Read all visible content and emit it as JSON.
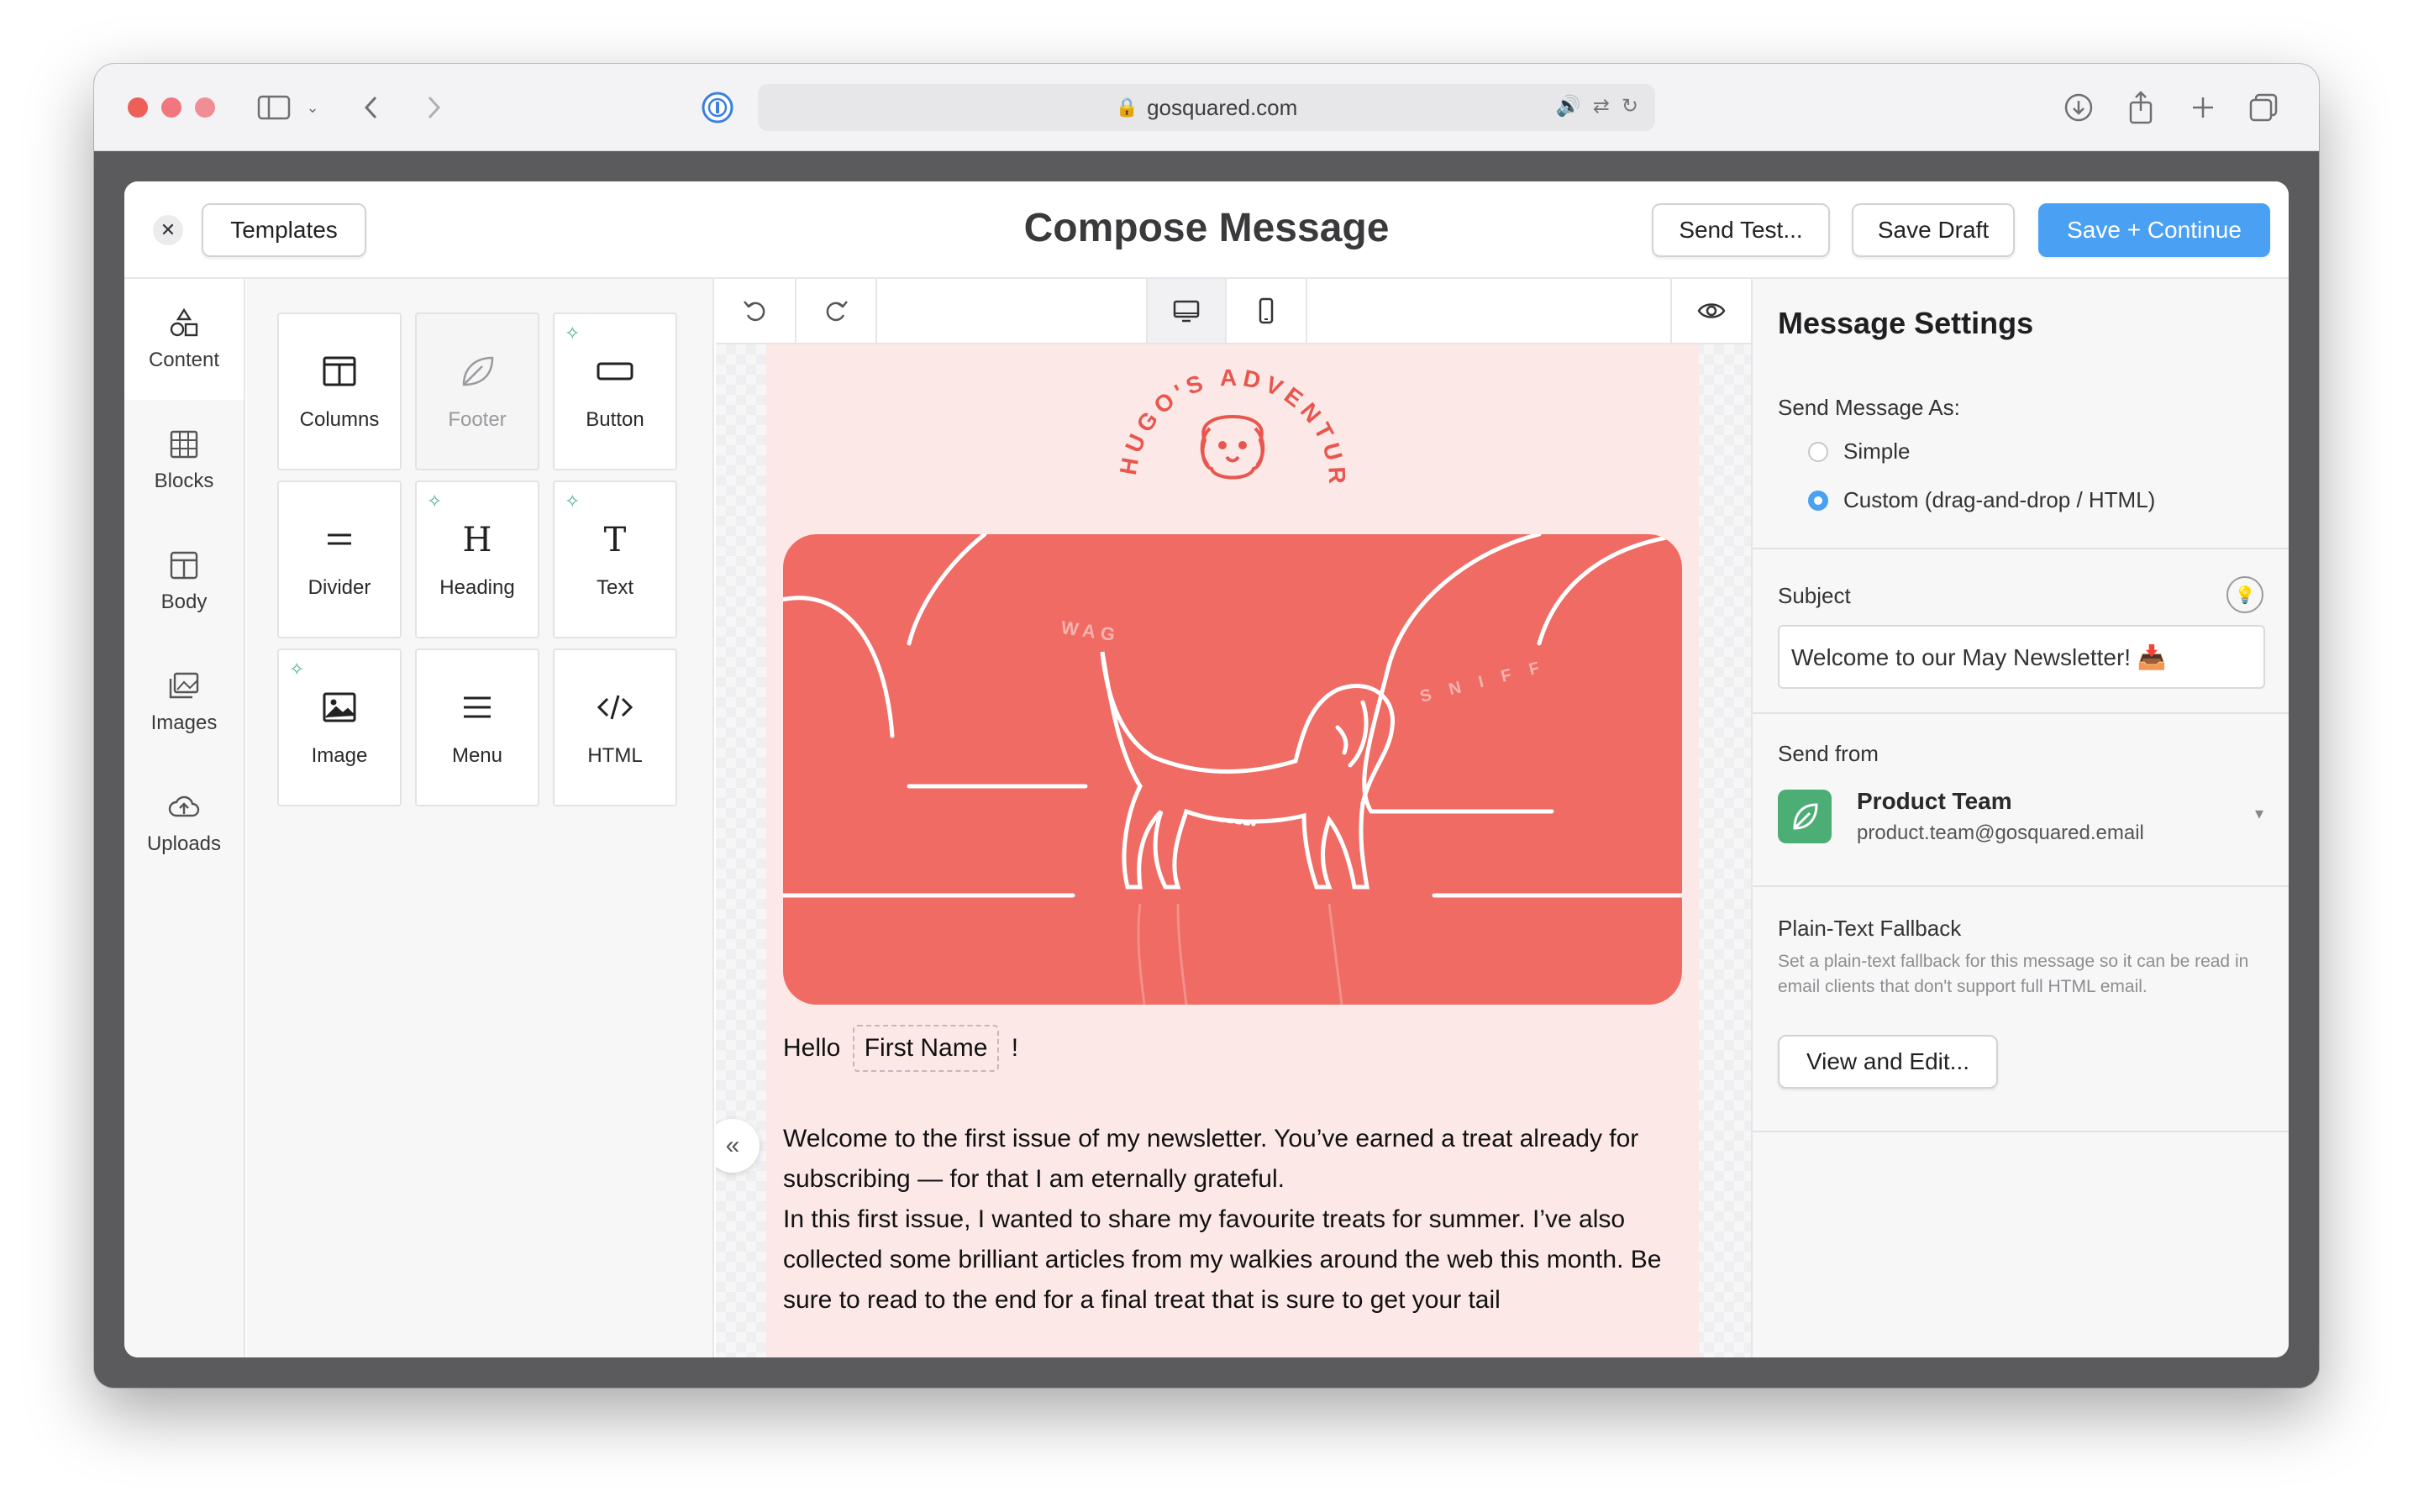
{
  "browser": {
    "url": "gosquared.com"
  },
  "header": {
    "templates_label": "Templates",
    "title": "Compose Message",
    "send_test_label": "Send Test...",
    "save_draft_label": "Save Draft",
    "save_continue_label": "Save + Continue"
  },
  "rail": {
    "items": [
      {
        "label": "Content",
        "icon": "shapes-icon"
      },
      {
        "label": "Blocks",
        "icon": "blocks-icon"
      },
      {
        "label": "Body",
        "icon": "layout-icon"
      },
      {
        "label": "Images",
        "icon": "images-icon"
      },
      {
        "label": "Uploads",
        "icon": "cloud-upload-icon"
      }
    ]
  },
  "tiles": [
    {
      "label": "Columns",
      "icon": "columns-icon",
      "new": false,
      "disabled": false
    },
    {
      "label": "Footer",
      "icon": "leaf-icon",
      "new": false,
      "disabled": true
    },
    {
      "label": "Button",
      "icon": "button-icon",
      "new": true,
      "disabled": false
    },
    {
      "label": "Divider",
      "icon": "divider-icon",
      "new": false,
      "disabled": false
    },
    {
      "label": "Heading",
      "icon": "heading-icon",
      "new": true,
      "disabled": false
    },
    {
      "label": "Text",
      "icon": "text-icon",
      "new": true,
      "disabled": false
    },
    {
      "label": "Image",
      "icon": "image-icon",
      "new": true,
      "disabled": false
    },
    {
      "label": "Menu",
      "icon": "menu-icon",
      "new": false,
      "disabled": false
    },
    {
      "label": "HTML",
      "icon": "code-icon",
      "new": false,
      "disabled": false
    }
  ],
  "email": {
    "logo_text": "HUGO'S ADVENTURES",
    "hero_words": {
      "wag": "WAG",
      "sniff": "SNIFF"
    },
    "greeting_prefix": "Hello",
    "merge_tag": "First Name",
    "greeting_suffix": "!",
    "paragraph1": "Welcome to the first issue of my newsletter. You’ve earned a treat already for subscribing — for that I am eternally grateful.",
    "paragraph2": "In this first issue, I wanted to share my favourite treats for summer. I’ve also collected some brilliant articles from my walkies around the web this month. Be sure to read to the end for a final treat that is sure to get your tail"
  },
  "settings": {
    "title": "Message Settings",
    "send_as_label": "Send Message As:",
    "options": [
      {
        "label": "Simple",
        "selected": false
      },
      {
        "label": "Custom (drag-and-drop / HTML)",
        "selected": true
      }
    ],
    "subject_label": "Subject",
    "subject_value": "Welcome to our May Newsletter! 📥",
    "send_from_label": "Send from",
    "sender_name": "Product Team",
    "sender_email": "product.team@gosquared.email",
    "plaintext_label": "Plain-Text Fallback",
    "plaintext_help": "Set a plain-text fallback for this message so it can be read in email clients that don't support full HTML email.",
    "view_edit_label": "View and Edit..."
  },
  "colors": {
    "accent": "#4aa1f3",
    "hero": "#ef6b63",
    "email_bg": "#fce8e6",
    "sender_avatar": "#4cae74",
    "sparkle": "#4cb38a"
  }
}
